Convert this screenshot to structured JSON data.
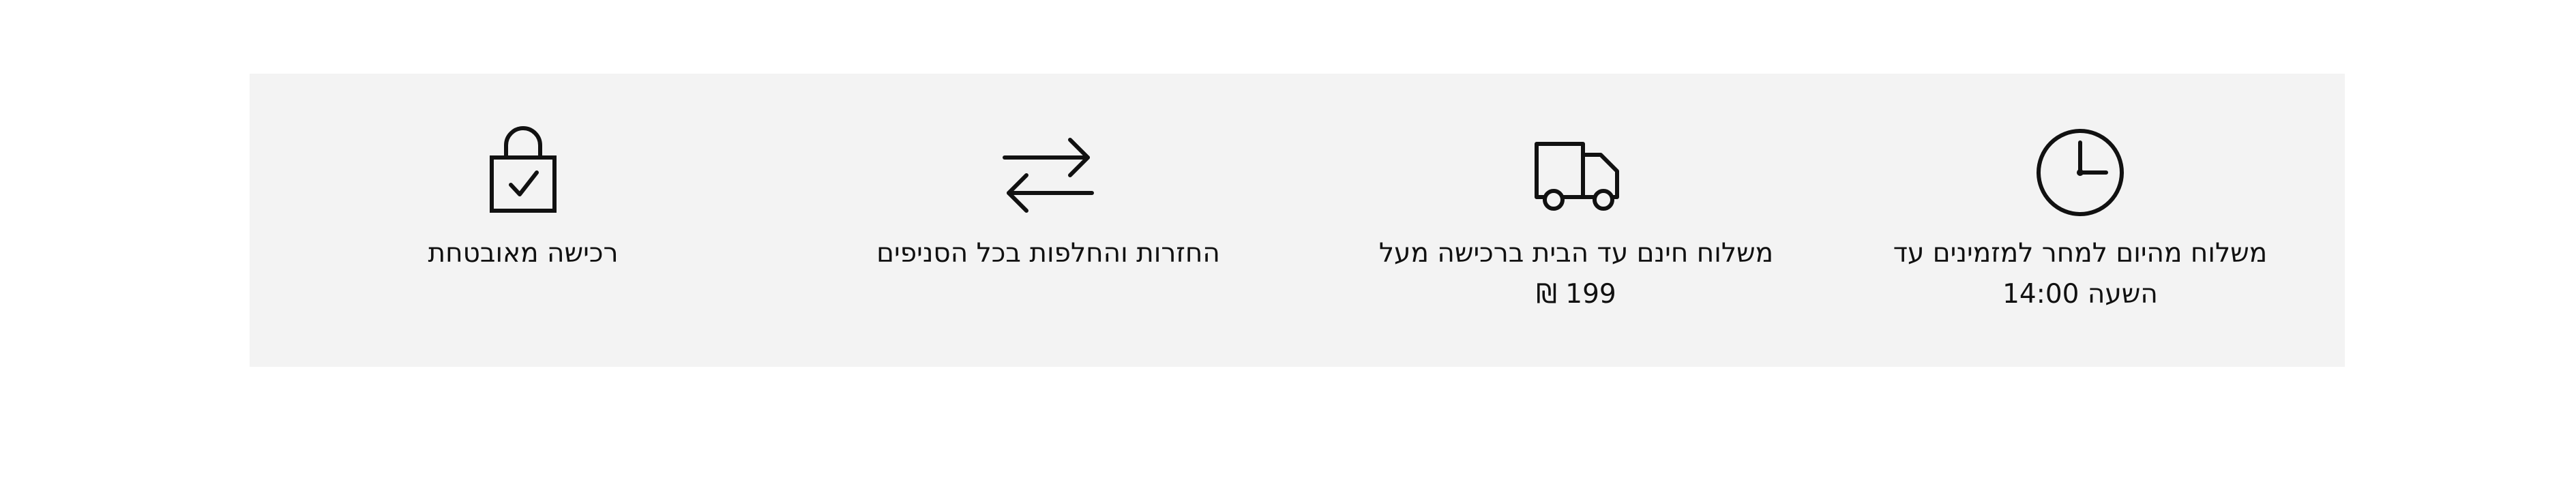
{
  "benefits_bar": {
    "items": [
      {
        "icon": "clock-icon",
        "lines": [
          "משלוח מהיום למחר למזמינים עד",
          "השעה 14:00"
        ]
      },
      {
        "icon": "delivery-truck-icon",
        "lines": [
          "משלוח חינם עד הבית ברכישה מעל",
          "199 ₪"
        ]
      },
      {
        "icon": "exchange-arrows-icon",
        "lines": [
          "החזרות והחלפות בכל הסניפים"
        ]
      },
      {
        "icon": "secure-lock-icon",
        "lines": [
          "רכישה מאובטחת"
        ]
      }
    ],
    "background_color": "#f3f3f3",
    "icon_color": "#111111"
  }
}
